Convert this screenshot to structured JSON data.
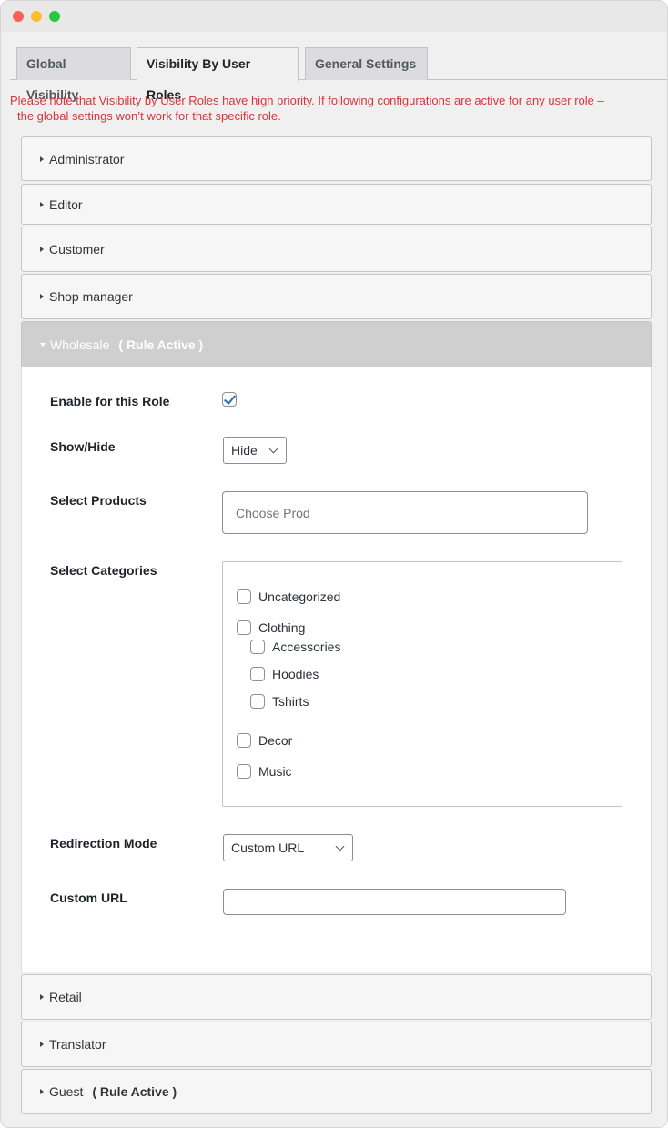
{
  "window": {
    "controls": [
      "close",
      "minimize",
      "maximize"
    ]
  },
  "tabs": [
    {
      "label": "Global Visibility",
      "active": false
    },
    {
      "label": "Visibility By User Roles",
      "active": true
    },
    {
      "label": "General Settings",
      "active": false
    }
  ],
  "notice": {
    "line1": "Please note that Visibility by User Roles have high priority. If following configurations are active for any user role –",
    "line2": "the global settings won’t work for that specific role.",
    "color": "#d63638"
  },
  "roles": [
    {
      "name": "Administrator",
      "active_label": "",
      "expanded": false
    },
    {
      "name": "Editor",
      "active_label": "",
      "expanded": false
    },
    {
      "name": "Customer",
      "active_label": "",
      "expanded": false
    },
    {
      "name": "Shop manager",
      "active_label": "",
      "expanded": false
    },
    {
      "name": "Wholesale",
      "active_label": "( Rule Active )",
      "expanded": true
    },
    {
      "name": "Retail",
      "active_label": "",
      "expanded": false
    },
    {
      "name": "Translator",
      "active_label": "",
      "expanded": false
    },
    {
      "name": "Guest",
      "active_label": "( Rule Active )",
      "expanded": false
    }
  ],
  "wholesale_form": {
    "enable_label": "Enable for this Role",
    "enable_checked": true,
    "showhide_label": "Show/Hide",
    "showhide_value": "Hide",
    "products_label": "Select Products",
    "products_placeholder": "Choose Prod",
    "categories_label": "Select Categories",
    "categories": [
      {
        "name": "Uncategorized",
        "checked": false,
        "level": 0
      },
      {
        "name": "Clothing",
        "checked": false,
        "level": 0
      },
      {
        "name": "Accessories",
        "checked": false,
        "level": 1
      },
      {
        "name": "Hoodies",
        "checked": false,
        "level": 1
      },
      {
        "name": "Tshirts",
        "checked": false,
        "level": 1
      },
      {
        "name": "Decor",
        "checked": false,
        "level": 0
      },
      {
        "name": "Music",
        "checked": false,
        "level": 0
      }
    ],
    "redirection_label": "Redirection Mode",
    "redirection_value": "Custom URL",
    "custom_url_label": "Custom URL",
    "custom_url_value": ""
  }
}
